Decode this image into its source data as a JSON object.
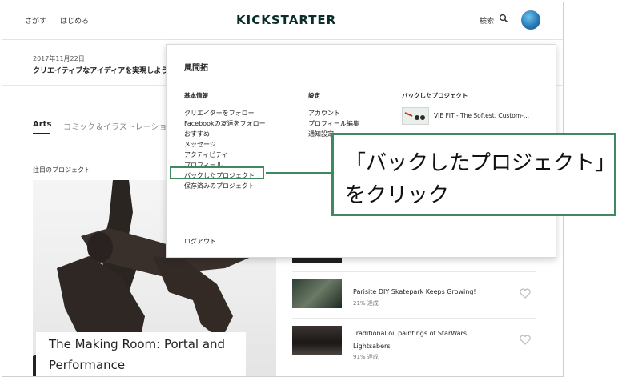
{
  "header": {
    "nav_search": "さがす",
    "nav_start": "はじめる",
    "logo": "KICKSTARTER",
    "search_label": "検索"
  },
  "date_strip": {
    "date": "2017年11月22日",
    "headline": "クリエイティブなアイディアを実現しよう"
  },
  "categories": {
    "active": "Arts",
    "second": "コミック＆イラストレーショ"
  },
  "featured": {
    "label": "注目のプロジェクト",
    "caption_line1": "The Making Room: Portal and",
    "caption_line2": "Performance"
  },
  "projects": [
    {
      "title": "Parisite DIY Skatepark Keeps Growing!",
      "pct": "21% 達成"
    },
    {
      "title": "Traditional oil paintings of StarWars",
      "title2": "Lightsabers",
      "pct": "91% 達成"
    }
  ],
  "dropdown": {
    "user_name": "風間拓",
    "col1_head": "基本情報",
    "col1_items": [
      "クリエイターをフォロー",
      "Facebookの友達をフォロー",
      "おすすめ",
      "メッセージ",
      "アクティビティ",
      "プロフィール",
      "バックしたプロジェクト",
      "保存済みのプロジェクト"
    ],
    "col2_head": "設定",
    "col2_items": [
      "アカウント",
      "プロフィール編集",
      "通知設定"
    ],
    "col3_head": "バックしたプロジェクト",
    "backed_title": "VIE FIT - The Softest, Custom-...",
    "logout": "ログアウト"
  },
  "callout": {
    "line1": "「バックしたプロジェクト」",
    "line2": "をクリック"
  },
  "colors": {
    "accent_green": "#3e8a60",
    "logo_dark": "#0b2e2a"
  }
}
